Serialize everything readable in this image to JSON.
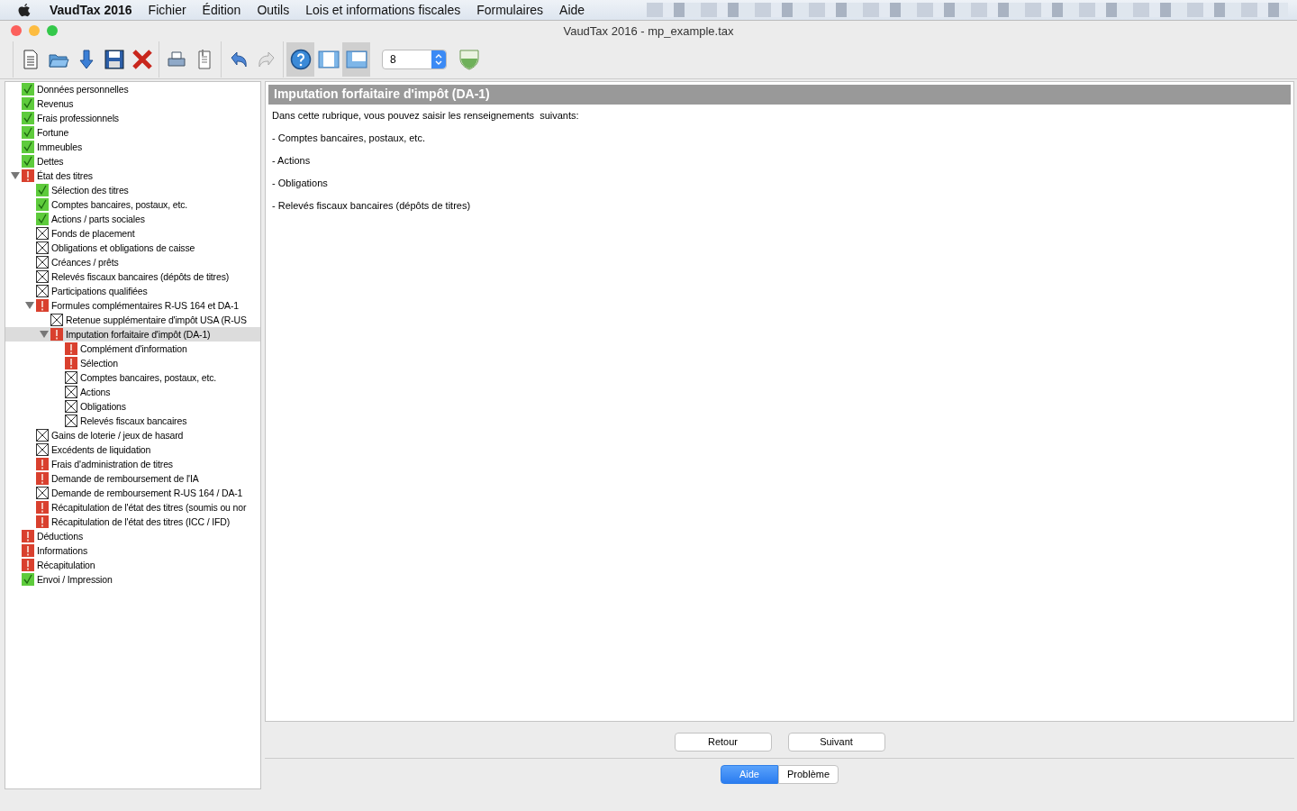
{
  "menu_bar": {
    "app_name": "VaudTax 2016",
    "items": [
      "Fichier",
      "Édition",
      "Outils",
      "Lois et informations fiscales",
      "Formulaires",
      "Aide"
    ]
  },
  "window": {
    "title": "VaudTax 2016 - mp_example.tax"
  },
  "toolbar": {
    "groups": [
      [
        {
          "kind": "new",
          "pressed": false
        },
        {
          "kind": "open",
          "pressed": false
        },
        {
          "kind": "import",
          "pressed": false
        },
        {
          "kind": "save",
          "pressed": false
        },
        {
          "kind": "delete",
          "pressed": false
        }
      ],
      [
        {
          "kind": "print",
          "pressed": false
        },
        {
          "kind": "attach",
          "pressed": false
        }
      ],
      [
        {
          "kind": "undo",
          "pressed": false
        },
        {
          "kind": "redo",
          "pressed": false
        }
      ],
      [
        {
          "kind": "help",
          "pressed": true
        },
        {
          "kind": "layout-columns",
          "pressed": false
        },
        {
          "kind": "layout-bottom",
          "pressed": true
        }
      ]
    ],
    "zoom_value": "8"
  },
  "tree": [
    {
      "label": "Données personnelles",
      "kind": "ok",
      "selected": false
    },
    {
      "label": "Revenus",
      "kind": "ok",
      "selected": false
    },
    {
      "label": "Frais professionnels",
      "kind": "ok",
      "selected": false
    },
    {
      "label": "Fortune",
      "kind": "ok",
      "selected": false
    },
    {
      "label": "Immeubles",
      "kind": "ok",
      "selected": false
    },
    {
      "label": "Dettes",
      "kind": "ok",
      "selected": false
    },
    {
      "label": "État des titres",
      "kind": "error",
      "selected": false,
      "expanded": true,
      "children": [
        {
          "label": "Sélection des titres",
          "kind": "ok",
          "selected": false
        },
        {
          "label": "Comptes bancaires, postaux, etc.",
          "kind": "ok",
          "selected": false
        },
        {
          "label": "Actions / parts sociales",
          "kind": "ok",
          "selected": false
        },
        {
          "label": "Fonds de placement",
          "kind": "empty",
          "selected": false
        },
        {
          "label": "Obligations et obligations de caisse",
          "kind": "empty",
          "selected": false
        },
        {
          "label": "Créances / prêts",
          "kind": "empty",
          "selected": false
        },
        {
          "label": "Relevés fiscaux bancaires (dépôts de titres)",
          "kind": "empty",
          "selected": false
        },
        {
          "label": "Participations qualifiées",
          "kind": "empty",
          "selected": false
        },
        {
          "label": "Formules complémentaires R-US 164 et DA-1",
          "kind": "error",
          "selected": false,
          "expanded": true,
          "children": [
            {
              "label": "Retenue supplémentaire d'impôt USA (R-US",
              "kind": "empty",
              "selected": false
            },
            {
              "label": "Imputation forfaitaire d'impôt (DA-1)",
              "kind": "error",
              "selected": true,
              "expanded": true,
              "children": [
                {
                  "label": "Complément d'information",
                  "kind": "error",
                  "selected": false
                },
                {
                  "label": "Sélection",
                  "kind": "error",
                  "selected": false
                },
                {
                  "label": "Comptes bancaires, postaux, etc.",
                  "kind": "empty",
                  "selected": false
                },
                {
                  "label": "Actions",
                  "kind": "empty",
                  "selected": false
                },
                {
                  "label": "Obligations",
                  "kind": "empty",
                  "selected": false
                },
                {
                  "label": "Relevés fiscaux bancaires",
                  "kind": "empty",
                  "selected": false
                }
              ]
            }
          ]
        },
        {
          "label": "Gains de loterie / jeux de hasard",
          "kind": "empty",
          "selected": false
        },
        {
          "label": "Excédents de liquidation",
          "kind": "empty",
          "selected": false
        },
        {
          "label": "Frais d'administration de titres",
          "kind": "error",
          "selected": false
        },
        {
          "label": "Demande de remboursement de l'IA",
          "kind": "error",
          "selected": false
        },
        {
          "label": "Demande de remboursement R-US 164 / DA-1",
          "kind": "empty",
          "selected": false
        },
        {
          "label": "Récapitulation de l'état des titres (soumis ou nor",
          "kind": "error",
          "selected": false
        },
        {
          "label": "Récapitulation de l'état des titres (ICC / IFD)",
          "kind": "error",
          "selected": false
        }
      ]
    },
    {
      "label": "Déductions",
      "kind": "error",
      "selected": false
    },
    {
      "label": "Informations",
      "kind": "error",
      "selected": false
    },
    {
      "label": "Récapitulation",
      "kind": "error",
      "selected": false
    },
    {
      "label": "Envoi / Impression",
      "kind": "ok",
      "selected": false
    }
  ],
  "content": {
    "heading": "Imputation forfaitaire d'impôt (DA-1)",
    "paragraphs": [
      "Dans cette rubrique, vous pouvez saisir les renseignements  suivants:",
      "- Comptes bancaires, postaux, etc.",
      "- Actions",
      "- Obligations",
      "- Relevés fiscaux bancaires (dépôts de titres)"
    ]
  },
  "nav_buttons": [
    "Retour",
    "Suivant"
  ],
  "bottom_tabs": [
    {
      "label": "Aide",
      "selected": true
    },
    {
      "label": "Problème",
      "selected": false
    }
  ]
}
